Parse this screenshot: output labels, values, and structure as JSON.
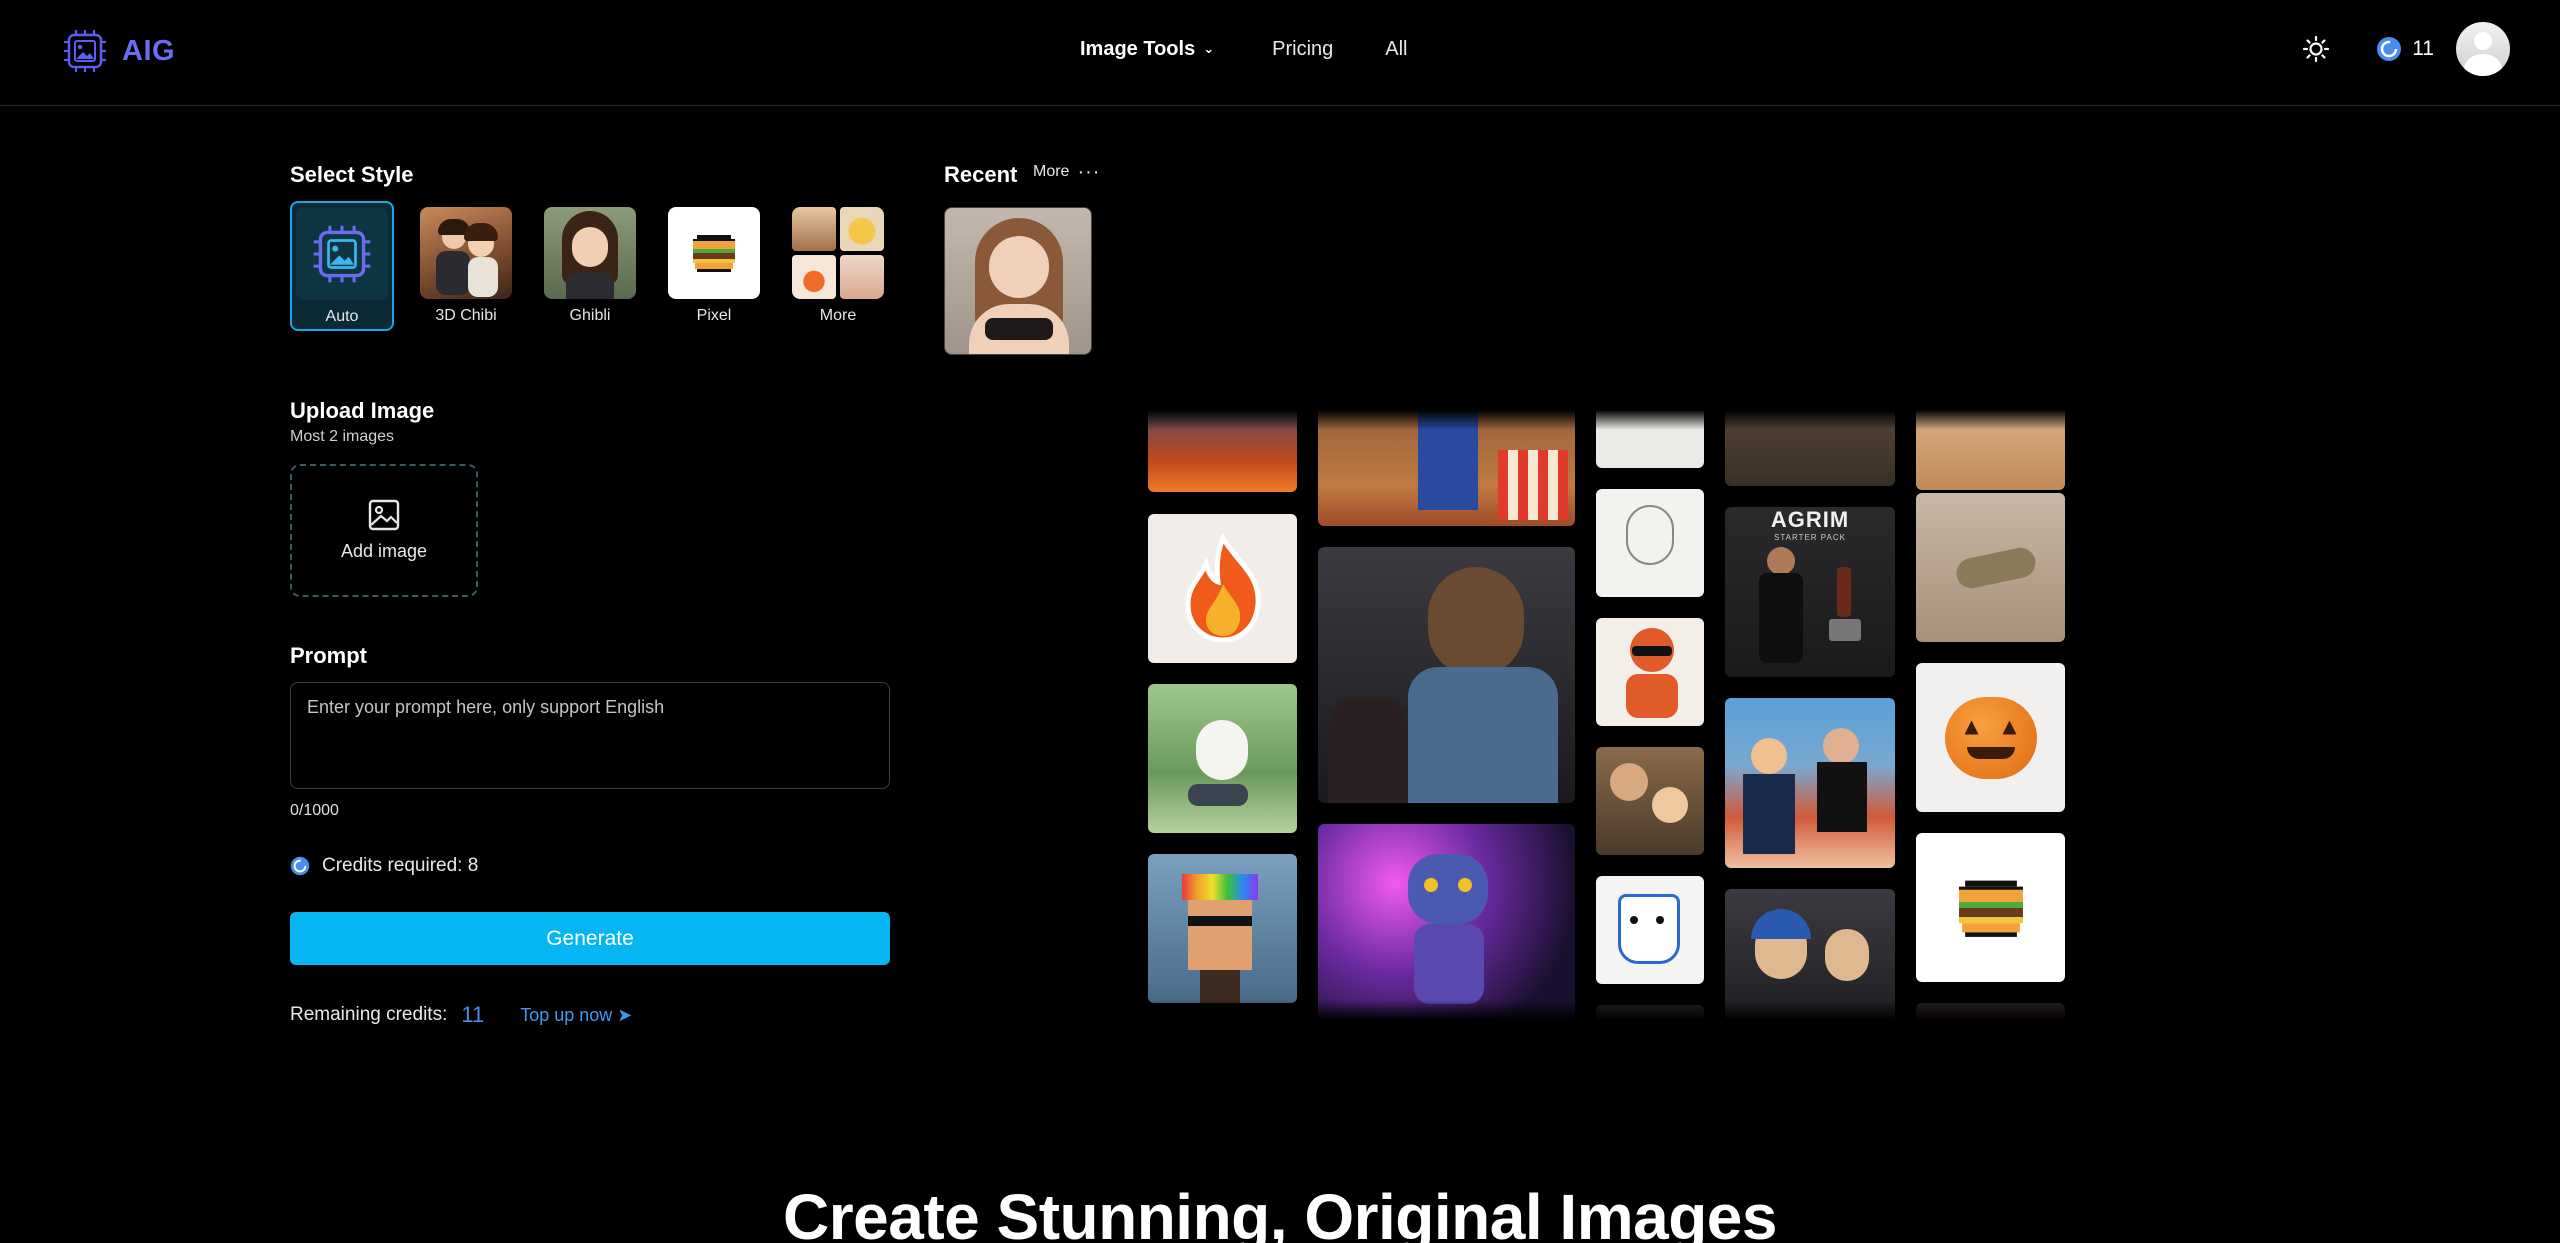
{
  "app": {
    "name": "AIG"
  },
  "nav": {
    "image_tools": "Image Tools",
    "pricing": "Pricing",
    "all": "All"
  },
  "header": {
    "credits": "11"
  },
  "style": {
    "title": "Select Style",
    "items": [
      {
        "label": "Auto"
      },
      {
        "label": "3D Chibi"
      },
      {
        "label": "Ghibli"
      },
      {
        "label": "Pixel"
      },
      {
        "label": "More"
      }
    ]
  },
  "recent": {
    "title": "Recent",
    "more": "More"
  },
  "upload": {
    "title": "Upload Image",
    "subtitle": "Most 2 images",
    "button": "Add image"
  },
  "prompt": {
    "title": "Prompt",
    "placeholder": "Enter your prompt here, only support English",
    "count": "0/1000"
  },
  "credits": {
    "required": "Credits required: 8",
    "remaining_label": "Remaining credits:",
    "remaining_value": "11",
    "top_up": "Top up now"
  },
  "generate": {
    "label": "Generate"
  },
  "gallery_text": {
    "poster_title": "AGRIM",
    "poster_sub": "STARTER PACK"
  },
  "hero": {
    "title": "Create Stunning, Original Images"
  },
  "colors": {
    "accent": "#06b6f3",
    "brand": "#6a6df0",
    "credit_blue": "#4a8df0"
  }
}
